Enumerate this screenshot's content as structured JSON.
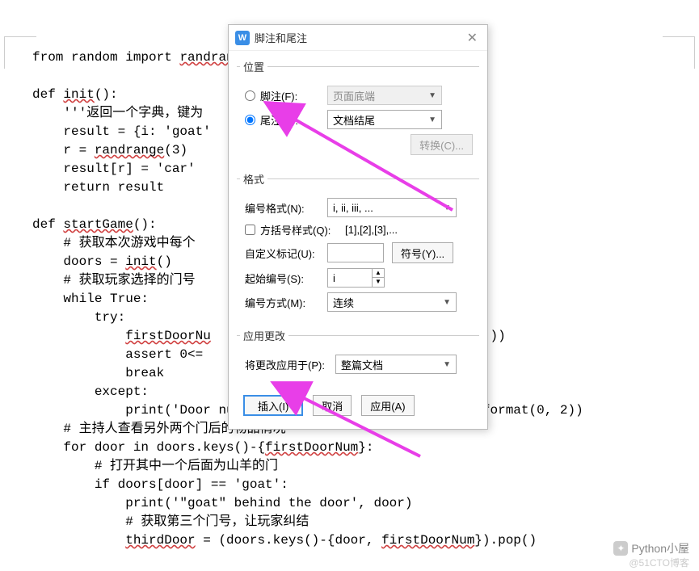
{
  "code": {
    "line1": "from random import ",
    "line1w": "randrange",
    "line2": "",
    "line3a": "def ",
    "line3w": "init",
    "line3b": "():",
    "line4": "    '''返回一个字典，键为",
    "line5": "    result = {i: 'goat'",
    "line6a": "    r = ",
    "line6w": "randrange",
    "line6b": "(3)",
    "line7": "    result[r] = 'car'",
    "line8": "    return result",
    "line9": "",
    "line10a": "def ",
    "line10w": "startGame",
    "line10b": "():",
    "line11": "    # 获取本次游戏中每个",
    "line12a": "    doors = ",
    "line12w": "init",
    "line12b": "()",
    "line13": "    # 获取玩家选择的门号",
    "line14": "    while True:",
    "line15": "        try:",
    "line16a": "            ",
    "line16w": "firstDoorNu",
    "line16b": "                            o open:'))",
    "line17": "            assert 0<= ",
    "line18": "            break",
    "line19": "        except:",
    "line20": "            print('Door number must be between {} and {}'.format(0, 2))",
    "line21": "    # 主持人查看另外两个门后的物品情况",
    "line22a": "    for door in doors.keys()-{",
    "line22w": "firstDoorNum",
    "line22b": "}:",
    "line23": "        # 打开其中一个后面为山羊的门",
    "line24": "        if doors[door] == 'goat':",
    "line25": "            print('\"goat\" behind the door', door)",
    "line26": "            # 获取第三个门号，让玩家纠结",
    "line27a": "            ",
    "line27w": "thirdDoor",
    "line27b": " = (doors.keys()-{door, ",
    "line27w2": "firstDoorNum",
    "line27c": "}).pop()"
  },
  "dialog": {
    "title": "脚注和尾注",
    "close": "✕",
    "position": {
      "legend": "位置",
      "footnote_label": "脚注(F):",
      "footnote_value": "页面底端",
      "endnote_label": "尾注(E):",
      "endnote_value": "文档结尾",
      "convert_btn": "转换(C)..."
    },
    "format": {
      "legend": "格式",
      "number_format_label": "编号格式(N):",
      "number_format_value": "i, ii, iii, ...",
      "bracket_label": "方括号样式(Q):",
      "bracket_sample": "[1],[2],[3],...",
      "custom_label": "自定义标记(U):",
      "symbol_btn": "符号(Y)...",
      "start_label": "起始编号(S):",
      "start_value": "i",
      "numbering_label": "编号方式(M):",
      "numbering_value": "连续"
    },
    "apply": {
      "legend": "应用更改",
      "apply_to_label": "将更改应用于(P):",
      "apply_to_value": "整篇文档"
    },
    "buttons": {
      "insert": "插入(I)",
      "cancel": "取消",
      "apply": "应用(A)"
    }
  },
  "watermark": {
    "text1": "Python小屋",
    "text2": "@51CTO博客"
  }
}
